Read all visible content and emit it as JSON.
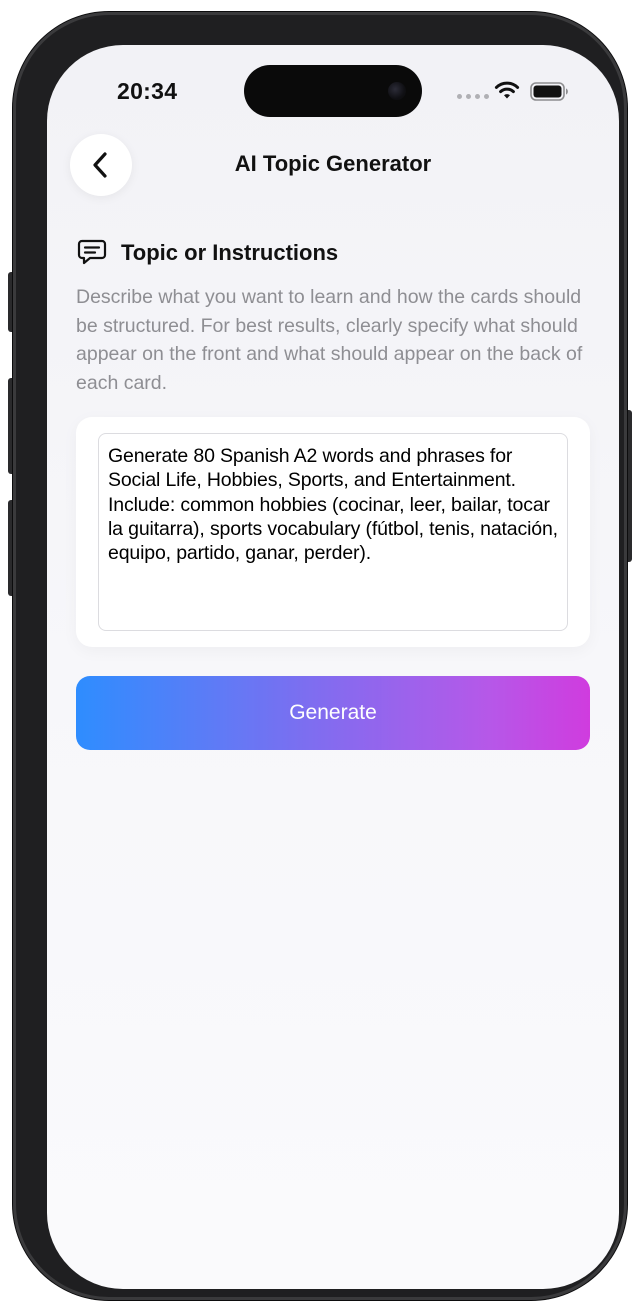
{
  "status_bar": {
    "time": "20:34"
  },
  "nav": {
    "back_icon": "chevron-left-icon",
    "title": "AI Topic Generator"
  },
  "section": {
    "icon": "chat-bubble-icon",
    "title": "Topic or Instructions",
    "description": "Describe what you want to learn and how the cards should be structured. For best results, clearly specify what should appear on the front and what should appear on the back of each card."
  },
  "input": {
    "value": "Generate 80 Spanish A2 words and phrases for Social Life, Hobbies, Sports, and Entertainment. Include: common hobbies (cocinar, leer, bailar, tocar la guitarra), sports vocabulary (fútbol, tenis, natación, equipo, partido, ganar, perder)."
  },
  "actions": {
    "generate_label": "Generate"
  },
  "colors": {
    "gradient_start": "#2a8bff",
    "gradient_end": "#cf38de",
    "secondary_text": "#8e8e93"
  }
}
